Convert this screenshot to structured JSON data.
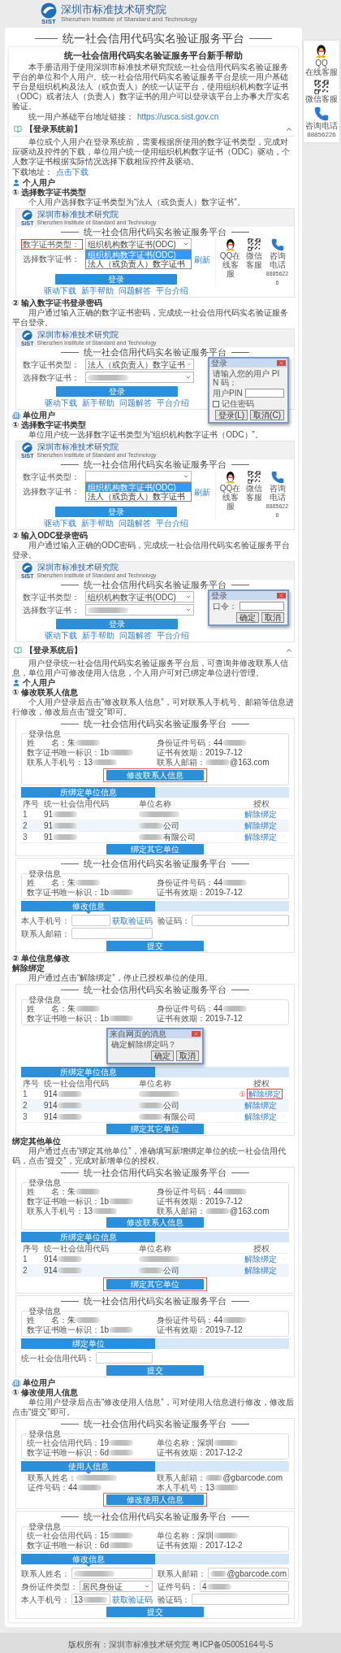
{
  "header": {
    "logo_text": "SIST",
    "org_name": "深圳市标准技术研究院",
    "org_name_en": "Shenzhen Institute of Standard and Technology"
  },
  "side_widget": [
    {
      "kind": "qq",
      "lines": [
        "QQ",
        "在线客服"
      ]
    },
    {
      "kind": "wechat",
      "lines": [
        "微信客服"
      ]
    },
    {
      "kind": "phone",
      "lines": [
        "咨询电话",
        "88856226"
      ]
    }
  ],
  "page_title": "统一社会信用代码实名验证服务平台",
  "help": {
    "title": "统一社会信用代码实名验证服务平台新手帮助",
    "intro": "本手册适用于使用深圳市标准技术研究院统一社会信用代码实名验证服务平台的单位和个人用户。统一社会信用代码实名验证服务平台是统一用户基础平台是组织机构及法人（或负责人）的统一认证平台，使用组织机构数字证书（ODC）或者法人（负责人）数字证书的用户可以登录该平台上办事大厅实名验证。",
    "link_label": "统一用户基础平台地址链接：",
    "link": "https://usca.sist.gov.cn",
    "sections": [
      {
        "title": "【登录系统前】",
        "expanded": true,
        "content": [
          {
            "kind": "text",
            "text": "单位或个人用户在登录系统前，需要根据所使用的数字证书类型，完成对应驱动及控件的下载，单位用户统一使用组织机构数字证书（ODC）驱动，个人数字证书根据实际情况选择下载相应控件及驱动。"
          },
          {
            "kind": "download",
            "label": "下载地址：",
            "link": "点击下载"
          },
          {
            "kind": "person",
            "text": "个人用户"
          },
          {
            "kind": "step",
            "text": "① 选择数字证书类型"
          },
          {
            "kind": "text",
            "text": "个人用户选择数字证书类型为“法人（或负责人）数字证书”。"
          },
          {
            "kind": "shot",
            "shot": {
              "kind": "login",
              "header": {
                "logo_text": "SIST",
                "org_name": "深圳市标准技术研究院",
                "org_name_en": "Shenzhen Institute of Standard and Technology"
              },
              "title": "统一社会信用代码实名验证服务平台",
              "fields": [
                {
                  "label": "数字证书类型：",
                  "value": {
                    "text": "组织机构数字证书(ODC)"
                  },
                  "highlighted": true
                },
                {
                  "label": "选择数字证书：",
                  "refresh": "刷新",
                  "highlighted": false
                }
              ],
              "dropdown": {
                "options": [
                  {
                    "text": "组织机构数字证书(ODC)",
                    "selected": true
                  },
                  {
                    "text": "法人（或负责人）数字证书",
                    "selected": false
                  }
                ]
              },
              "button": "登录",
              "links": [
                "驱动下载",
                "新手帮助",
                "问题解答",
                "平台介绍"
              ],
              "contacts": [
                {
                  "kind": "qq",
                  "lines": [
                    "QQ在线客服"
                  ]
                },
                {
                  "kind": "wechat",
                  "lines": [
                    "微信客服"
                  ]
                },
                {
                  "kind": "phone",
                  "lines": [
                    "咨询电话",
                    "88856226"
                  ]
                }
              ]
            }
          },
          {
            "kind": "step",
            "text": "② 输入数字证书登录密码"
          },
          {
            "kind": "text",
            "text": "用户通过输入正确的数字证书密码，完成统一社会信用代码实名验证服务平台登录。"
          },
          {
            "kind": "shot",
            "shot": {
              "kind": "login",
              "header": {
                "logo_text": "SIST",
                "org_name": "深圳市标准技术研究院",
                "org_name_en": "Shenzhen Institute of Standard and Technology"
              },
              "title": "统一社会信用代码实名验证服务平台",
              "fields": [
                {
                  "label": "数字证书类型：",
                  "value": {
                    "text": "法人（或负责人）数字证书"
                  }
                },
                {
                  "label": "选择数字证书：",
                  "value": {
                    "kind": "hidden"
                  }
                }
              ],
              "button": "登录",
              "links": [
                "驱动下载",
                "新手帮助",
                "问题解答",
                "平台介绍"
              ],
              "dialog": {
                "title": "登录",
                "message": "请输入您的用户 PIN 码：",
                "field_label": "用户PIN",
                "checkbox": {
                  "label": "记住密码",
                  "checked": false
                },
                "buttons": [
                  "登录(L)",
                  "取消(C)"
                ]
              }
            }
          },
          {
            "kind": "unit",
            "text": "单位用户"
          },
          {
            "kind": "step",
            "text": "① 选择数字证书类型"
          },
          {
            "kind": "text",
            "text": "单位用户统一选择数字证书类型为“组织机构数字证书（ODC）”。"
          },
          {
            "kind": "shot",
            "shot": {
              "kind": "login",
              "header": {
                "logo_text": "SIST",
                "org_name": "深圳市标准技术研究院",
                "org_name_en": "Shenzhen Institute of Standard and Technology"
              },
              "title": "统一社会信用代码实名验证服务平台",
              "fields": [
                {
                  "label": "数字证书类型："
                },
                {
                  "label": "选择数字证书：",
                  "refresh": "刷新"
                }
              ],
              "dropdown": {
                "options": [
                  {
                    "text": "组织机构数字证书(ODC)",
                    "selected": true
                  },
                  {
                    "text": "法人（或负责人）数字证书",
                    "selected": false
                  }
                ]
              },
              "button": "登录",
              "links": [
                "驱动下载",
                "新手帮助",
                "问题解答",
                "平台介绍"
              ],
              "contacts": [
                {
                  "kind": "qq",
                  "lines": [
                    "QQ在线客服"
                  ]
                },
                {
                  "kind": "wechat",
                  "lines": [
                    "微信客服"
                  ]
                },
                {
                  "kind": "phone",
                  "lines": [
                    "咨询电话",
                    "88856226"
                  ]
                }
              ]
            }
          },
          {
            "kind": "step",
            "text": "② 输入ODC登录密码"
          },
          {
            "kind": "text",
            "text": "用户通过输入正确的ODC密码，完成统一社会信用代码实名验证服务平台登录。"
          },
          {
            "kind": "shot",
            "shot": {
              "kind": "login",
              "header": {
                "logo_text": "SIST",
                "org_name": "深圳市标准技术研究院",
                "org_name_en": "Shenzhen Institute of Standard and Technology"
              },
              "title": "统一社会信用代码实名验证服务平台",
              "fields": [
                {
                  "label": "数字证书类型：",
                  "value": {
                    "text": "组织机构数字证书(ODC)"
                  }
                },
                {
                  "label": "选择数字证书：",
                  "value": {
                    "kind": "hidden"
                  }
                }
              ],
              "button": "登录",
              "links": [
                "驱动下载",
                "新手帮助",
                "问题解答",
                "平台介绍"
              ],
              "dialog": {
                "title": "登录",
                "field_label": "口令：",
                "buttons": [
                  "确定",
                  "取消"
                ]
              }
            }
          }
        ]
      },
      {
        "title": "【登录系统后】",
        "expanded": true,
        "content": [
          {
            "kind": "text",
            "text": "用户登录统一社会信用代码实名验证服务平台后，可查询并修改联系人信息，单位用户可修改使用人信息，个人用户可对已绑定单位进行管理。"
          },
          {
            "kind": "person",
            "text": "个人用户"
          },
          {
            "kind": "step",
            "text": "① 修改联系人信息"
          },
          {
            "kind": "text",
            "text": "个人用户登录后点击“修改联系人信息”，可对联系人手机号、邮箱等信息进行修改，修改后点击“提交”即可。"
          },
          {
            "kind": "shot",
            "shot": {
              "kind": "profile",
              "title": "统一社会信用代码实名验证服务平台",
              "legend": "登录信息",
              "info": [
                {
                  "label": "姓　　名：",
                  "value": {
                    "text": "朱",
                    "kind": "masked"
                  }
                },
                {
                  "label": "身份证件号码：",
                  "value": {
                    "text": "44",
                    "kind": "masked"
                  }
                },
                {
                  "label": "数字证书唯一标识：",
                  "value": {
                    "text": "1b",
                    "kind": "masked"
                  }
                },
                {
                  "label": "证书有效期：",
                  "value": {
                    "text": "2019-7-12"
                  }
                },
                {
                  "label": "联系人手机号：",
                  "value": {
                    "text": "13",
                    "kind": "masked"
                  }
                },
                {
                  "label": "联系人邮箱：",
                  "value": {
                    "text": "@163.com",
                    "kind": "suffix"
                  }
                }
              ],
              "button": {
                "text": "修改联系人信息",
                "highlighted": true
              },
              "tab": "所绑定单位信息",
              "table": {
                "columns": [
                  "序号",
                  "统一社会信用代码",
                  "单位名称",
                  "授权"
                ],
                "rows": [
                  {
                    "index": "1",
                    "code": {
                      "text": "91",
                      "kind": "masked"
                    },
                    "name": {
                      "kind": "hidden"
                    },
                    "action": "解除绑定"
                  },
                  {
                    "index": "2",
                    "code": {
                      "text": "91",
                      "kind": "masked"
                    },
                    "name": {
                      "text": "公司",
                      "kind": "suffix"
                    },
                    "action": "解除绑定"
                  },
                  {
                    "index": "3",
                    "code": {
                      "text": "91",
                      "kind": "masked"
                    },
                    "name": {
                      "text": "有限公司",
                      "kind": "suffix"
                    },
                    "action": "解除绑定"
                  }
                ]
              },
              "bottom_button": {
                "text": "绑定其它单位",
                "highlighted": false
              }
            }
          },
          {
            "kind": "shot",
            "shot": {
              "kind": "form",
              "title": "统一社会信用代码实名验证服务平台",
              "legend": "登录信息",
              "info": [
                {
                  "label": "姓　　名：",
                  "value": {
                    "text": "朱",
                    "kind": "masked"
                  }
                },
                {
                  "label": "身份证件号码：",
                  "value": {
                    "text": "44",
                    "kind": "masked"
                  }
                },
                {
                  "label": "数字证书唯一标识：",
                  "value": {
                    "text": "1b",
                    "kind": "masked"
                  }
                },
                {
                  "label": "证书有效期：",
                  "value": {
                    "text": "2019-7-12"
                  }
                }
              ],
              "tab": "修改信息",
              "fields": [
                {
                  "kind": "input",
                  "label": "本人手机号：",
                  "action": "获取验证码"
                },
                {
                  "kind": "input",
                  "label": "验证码："
                },
                {
                  "kind": "input",
                  "label": "联系人邮箱："
                }
              ],
              "submit": "提交"
            }
          },
          {
            "kind": "step",
            "text": "② 单位信息修改"
          },
          {
            "kind": "subheading",
            "text": "解除绑定"
          },
          {
            "kind": "text",
            "text": "用户通过点击“解除绑定”，停止已授权单位的使用。"
          },
          {
            "kind": "shot",
            "shot": {
              "kind": "profile",
              "title": "统一社会信用代码实名验证服务平台",
              "legend": "登录信息",
              "info": [
                {
                  "label": "姓　　名：",
                  "value": {
                    "text": "朱",
                    "kind": "masked"
                  }
                },
                {
                  "label": "身份证件号码：",
                  "value": {
                    "text": "44",
                    "kind": "masked"
                  }
                },
                {
                  "label": "数字证书唯一标识：",
                  "value": {
                    "text": "1b",
                    "kind": "masked"
                  }
                },
                {
                  "label": "证书有效期：",
                  "value": {
                    "text": "2019-7-12"
                  }
                }
              ],
              "dialog": {
                "title": "来自网页的消息",
                "message": "确定解除绑定吗？",
                "buttons": [
                  "确定",
                  "取消"
                ]
              },
              "tab": "所绑定单位信息",
              "table": {
                "columns": [
                  "序号",
                  "统一社会信用代码",
                  "单位名称",
                  "授权"
                ],
                "rows": [
                  {
                    "index": "1",
                    "code": {
                      "text": "914",
                      "kind": "masked"
                    },
                    "name": {
                      "kind": "hidden"
                    },
                    "action": "解除绑定",
                    "highlighted": true,
                    "marker": "①"
                  },
                  {
                    "index": "2",
                    "code": {
                      "text": "914",
                      "kind": "masked"
                    },
                    "name": {
                      "text": "公司",
                      "kind": "suffix"
                    },
                    "action": "解除绑定",
                    "highlighted": false
                  },
                  {
                    "index": "3",
                    "code": {
                      "text": "914",
                      "kind": "masked"
                    },
                    "name": {
                      "text": "有限公司",
                      "kind": "suffix"
                    },
                    "action": "解除绑定",
                    "highlighted": false
                  }
                ]
              },
              "bottom_button": {
                "text": "绑定其它单位",
                "highlighted": false
              }
            }
          },
          {
            "kind": "subheading",
            "text": "绑定其他单位"
          },
          {
            "kind": "text",
            "text": "用户通过点击“绑定其他单位”，准确填写新增绑定单位的统一社会信用代码，点击“提交”，完成对新增单位的授权。"
          },
          {
            "kind": "shot",
            "shot": {
              "kind": "profile",
              "title": "统一社会信用代码实名验证服务平台",
              "legend": "登录信息",
              "info": [
                {
                  "label": "姓　　名：",
                  "value": {
                    "text": "朱",
                    "kind": "masked"
                  }
                },
                {
                  "label": "身份证件号码：",
                  "value": {
                    "text": "44",
                    "kind": "masked"
                  }
                },
                {
                  "label": "数字证书唯一标识：",
                  "value": {
                    "text": "1b",
                    "kind": "masked"
                  }
                },
                {
                  "label": "证书有效期：",
                  "value": {
                    "text": "2019-7-12"
                  }
                },
                {
                  "label": "联系人手机号：",
                  "value": {
                    "text": "13",
                    "kind": "masked"
                  }
                },
                {
                  "label": "联系人邮箱：",
                  "value": {
                    "text": "@163.com",
                    "kind": "suffix"
                  }
                }
              ],
              "button": {
                "text": "修改联系人信息",
                "highlighted": false
              },
              "tab": "所绑定单位信息",
              "table": {
                "columns": [
                  "序号",
                  "统一社会信用代码",
                  "单位名称",
                  "授权"
                ],
                "rows": [
                  {
                    "index": "1",
                    "code": {
                      "text": "914",
                      "kind": "masked"
                    },
                    "name": {
                      "kind": "hidden"
                    },
                    "action": "解除绑定"
                  },
                  {
                    "index": "2",
                    "code": {
                      "text": "914",
                      "kind": "masked"
                    },
                    "name": {
                      "text": "公司",
                      "kind": "suffix"
                    },
                    "action": "解除绑定"
                  }
                ]
              },
              "bottom_button": {
                "text": "绑定其它单位",
                "highlighted": true
              }
            }
          },
          {
            "kind": "shot",
            "shot": {
              "kind": "form",
              "title": "统一社会信用代码实名验证服务平台",
              "legend": "登录信息",
              "info": [
                {
                  "label": "姓　　名：",
                  "value": {
                    "text": "朱",
                    "kind": "masked"
                  }
                },
                {
                  "label": "身份证件号码：",
                  "value": {
                    "text": "44",
                    "kind": "masked"
                  }
                },
                {
                  "label": "数字证书唯一标识：",
                  "value": {
                    "text": "1b",
                    "kind": "masked"
                  }
                },
                {
                  "label": "证书有效期：",
                  "value": {
                    "text": "2019-7-12"
                  }
                }
              ],
              "tab": "绑定单位",
              "fields": [
                {
                  "kind": "input",
                  "label": "统一社会信用代码："
                }
              ],
              "submit": "提交"
            }
          },
          {
            "kind": "unit",
            "text": "单位用户"
          },
          {
            "kind": "step",
            "text": "① 修改使用人信息"
          },
          {
            "kind": "text",
            "text": "单位用户登录后点击“修改使用人信息”，可对使用人信息进行修改，修改后点击“提交”即可。"
          },
          {
            "kind": "shot",
            "shot": {
              "kind": "profile",
              "title": "统一社会信用代码实名验证服务平台",
              "legend": "登录信息",
              "info": [
                {
                  "label": "统一社会信用代码：",
                  "value": {
                    "text": "19",
                    "kind": "masked"
                  }
                },
                {
                  "label": "单位名称：",
                  "value": {
                    "text": "深圳",
                    "kind": "masked"
                  }
                },
                {
                  "label": "数字证书唯一标识：",
                  "value": {
                    "text": "6d",
                    "kind": "masked"
                  }
                },
                {
                  "label": "证书有效期：",
                  "value": {
                    "text": "2017-12-2"
                  }
                }
              ],
              "tab": "使用人信息",
              "details": [
                {
                  "label": "联系人姓名：",
                  "value": {
                    "kind": "hidden"
                  }
                },
                {
                  "label": "联系人邮箱：",
                  "value": {
                    "text": "@gbarcode.com",
                    "kind": "suffix"
                  }
                },
                {
                  "label": "证件号码：",
                  "value": {
                    "text": "44",
                    "kind": "masked"
                  }
                },
                {
                  "label": "本人手机号：",
                  "value": {
                    "text": "13",
                    "kind": "masked"
                  }
                }
              ],
              "button": {
                "text": "修改使用人信息",
                "highlighted": true
              }
            }
          },
          {
            "kind": "shot",
            "shot": {
              "kind": "form",
              "title": "统一社会信用代码实名验证服务平台",
              "legend": "登录信息",
              "info": [
                {
                  "label": "统一社会信用代码：",
                  "value": {
                    "text": "15",
                    "kind": "masked"
                  }
                },
                {
                  "label": "单位名称：",
                  "value": {
                    "text": "深圳",
                    "kind": "masked"
                  }
                },
                {
                  "label": "数字证书唯一标识：",
                  "value": {
                    "text": "6d",
                    "kind": "masked"
                  }
                },
                {
                  "label": "证书有效期：",
                  "value": {
                    "text": "2017-12-2"
                  }
                }
              ],
              "tab": "修改信息",
              "fields": [
                {
                  "kind": "input",
                  "label": "联系人姓名：",
                  "value": {
                    "kind": "hidden"
                  }
                },
                {
                  "kind": "input",
                  "label": "联系人邮箱：",
                  "value": {
                    "text": "@gbarcode.com",
                    "kind": "suffix"
                  }
                },
                {
                  "kind": "select",
                  "label": "身份证件类型：",
                  "value": {
                    "text": "居民身份证"
                  }
                },
                {
                  "kind": "input",
                  "label": "证件号码：",
                  "value": {
                    "text": "4",
                    "kind": "masked"
                  }
                },
                {
                  "kind": "input",
                  "label": "本人手机号：",
                  "value": {
                    "text": "13",
                    "kind": "masked"
                  },
                  "action": "获取验证码"
                },
                {
                  "kind": "input",
                  "label": "验证码："
                }
              ],
              "submit": "提交"
            }
          }
        ]
      }
    ]
  },
  "footer": "版权所有：深圳市标准技术研究院 粤ICP备05005164号-5"
}
